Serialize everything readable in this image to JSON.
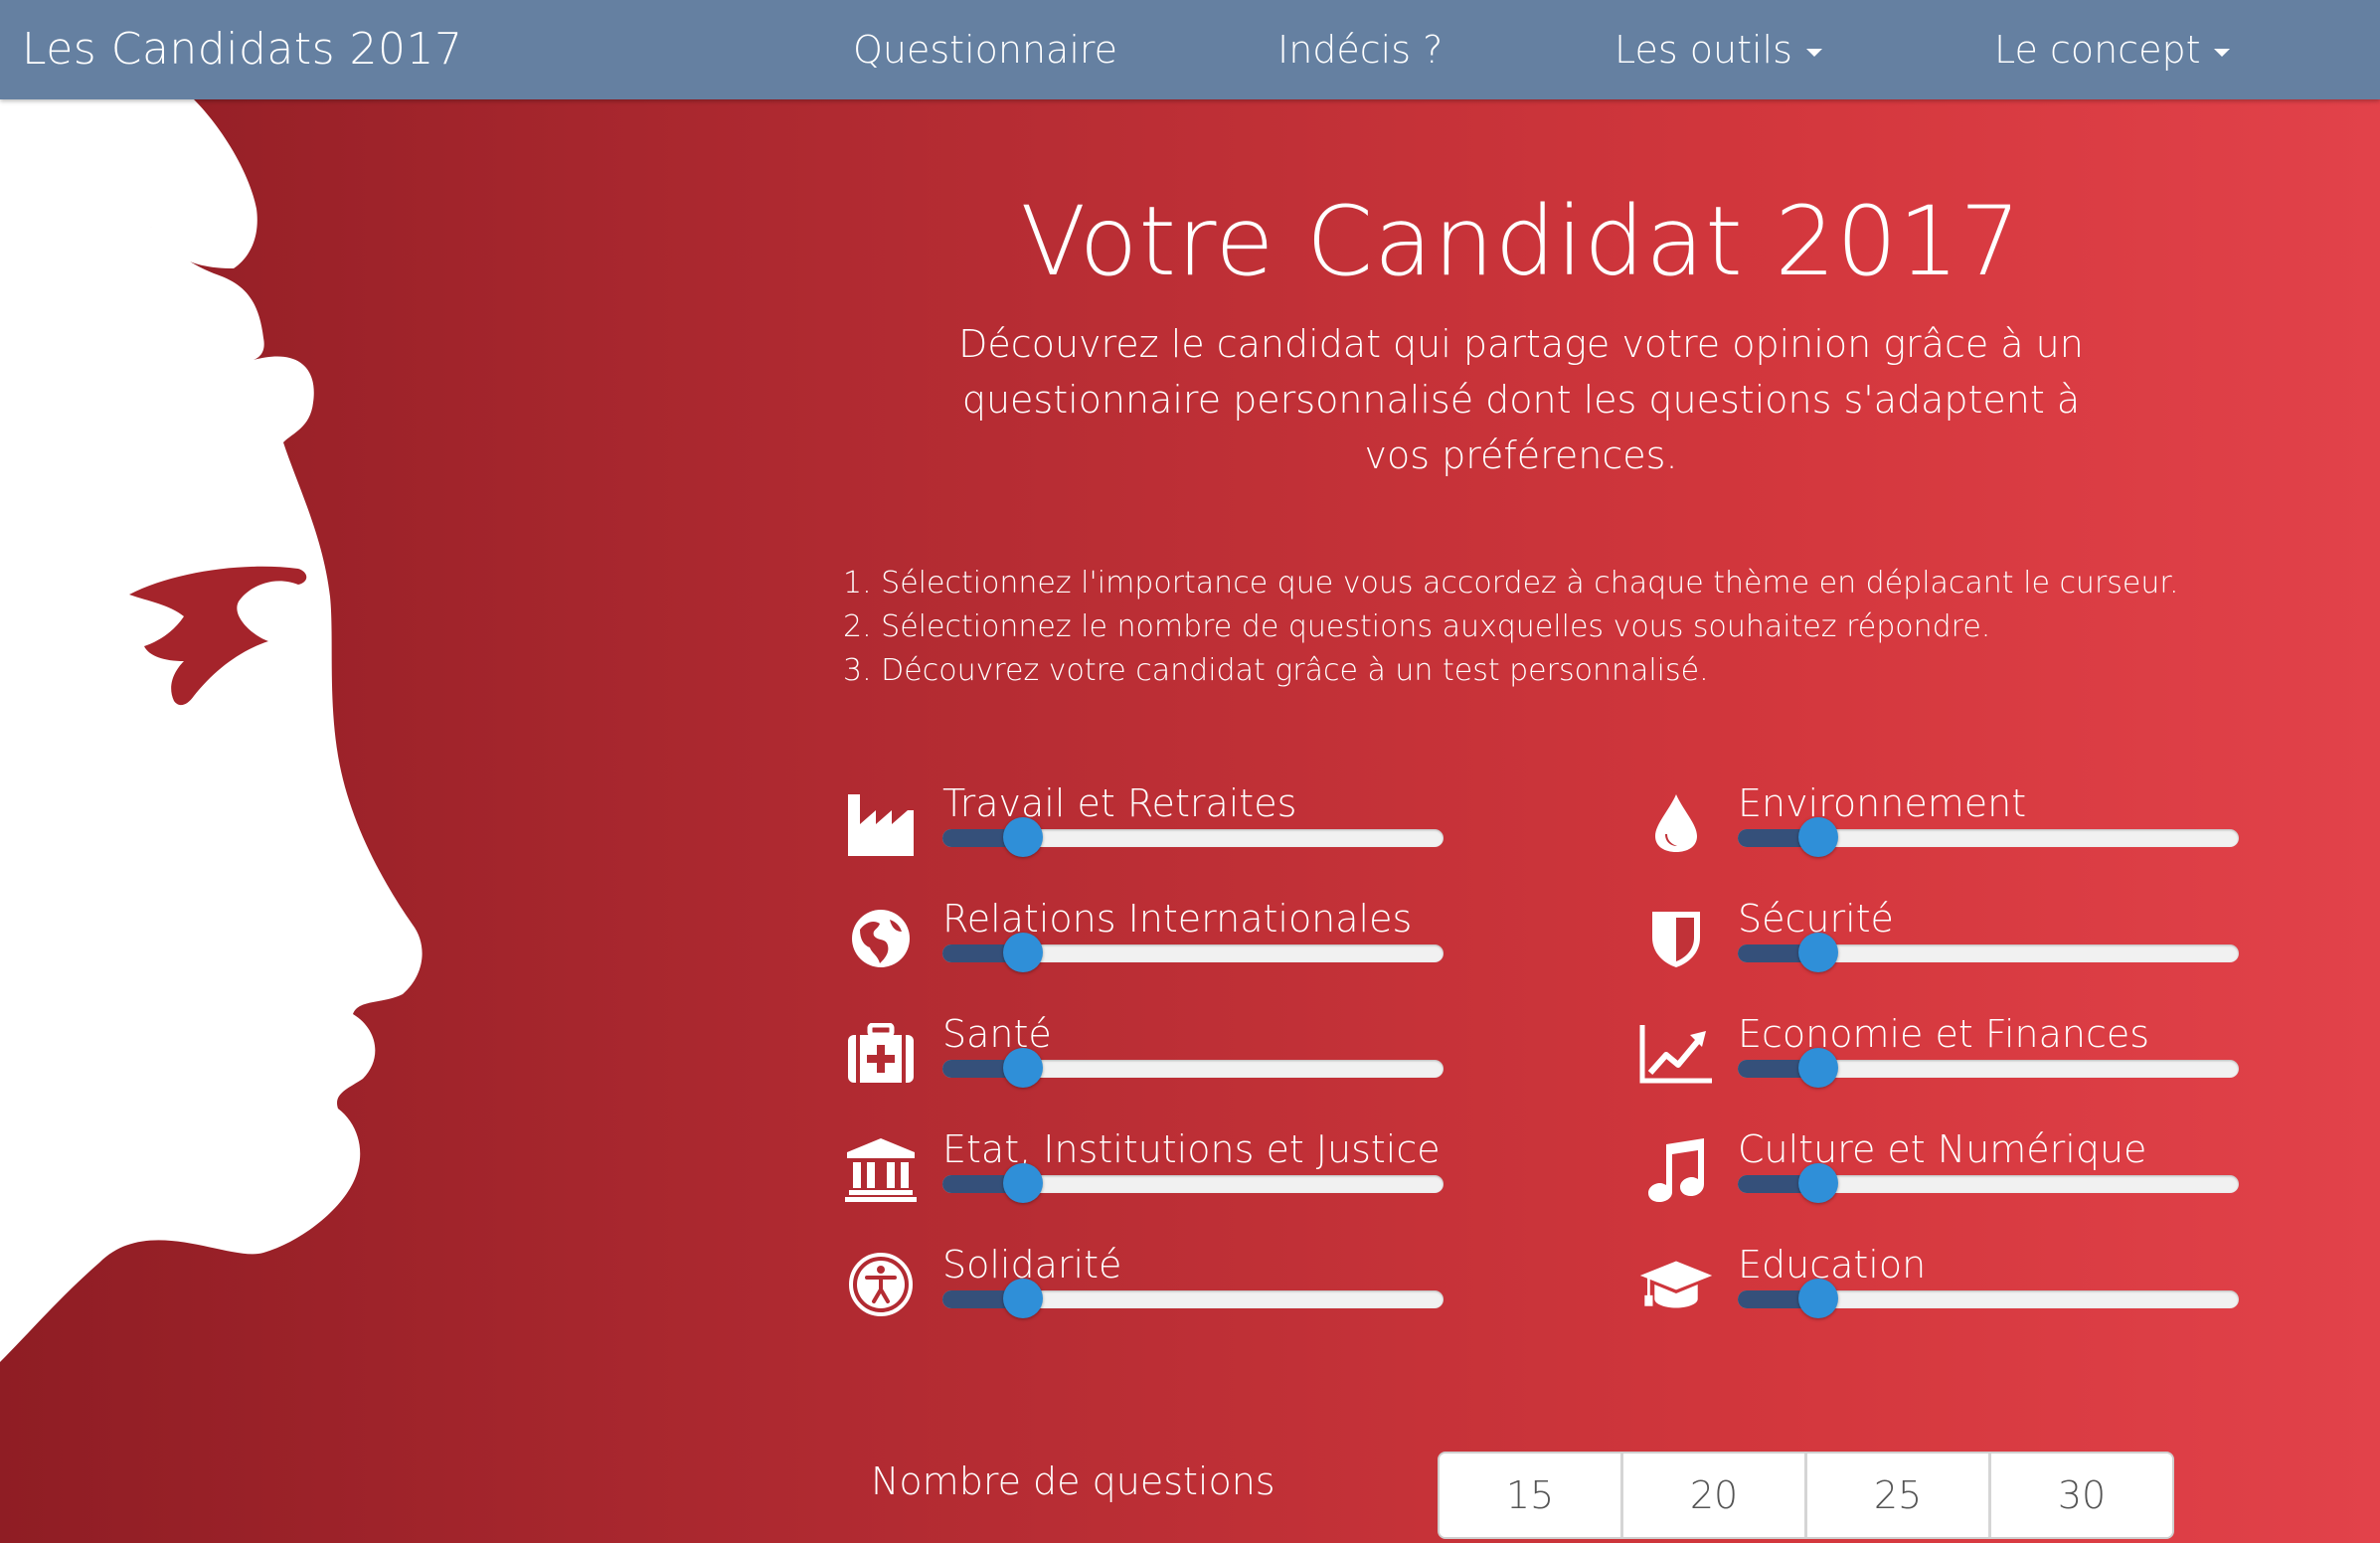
{
  "navbar": {
    "brand": "Les Candidats 2017",
    "items": [
      {
        "label": "Questionnaire",
        "dropdown": false
      },
      {
        "label": "Indécis ?",
        "dropdown": false
      },
      {
        "label": "Les outils",
        "dropdown": true
      },
      {
        "label": "Le concept",
        "dropdown": true
      }
    ]
  },
  "hero": {
    "title": "Votre Candidat 2017",
    "subtitle": "Découvrez le candidat qui partage votre opinion grâce à un questionnaire personnalisé dont les questions s'adaptent à vos préférences."
  },
  "steps": [
    "1. Sélectionnez l'importance que vous accordez à chaque thème en déplacant le curseur.",
    "2. Sélectionnez le nombre de questions auxquelles vous souhaitez répondre.",
    "3. Découvrez votre candidat grâce à un test personnalisé."
  ],
  "themes": [
    {
      "label": "Travail et Retraites",
      "icon": "factory-icon",
      "value": 0.16
    },
    {
      "label": "Environnement",
      "icon": "drop-icon",
      "value": 0.16
    },
    {
      "label": "Relations Internationales",
      "icon": "globe-icon",
      "value": 0.16
    },
    {
      "label": "Sécurité",
      "icon": "shield-icon",
      "value": 0.16
    },
    {
      "label": "Santé",
      "icon": "medkit-icon",
      "value": 0.16
    },
    {
      "label": "Economie et Finances",
      "icon": "line-chart-icon",
      "value": 0.16
    },
    {
      "label": "Etat, Institutions et Justice",
      "icon": "institution-icon",
      "value": 0.16
    },
    {
      "label": "Culture et Numérique",
      "icon": "music-icon",
      "value": 0.16
    },
    {
      "label": "Solidarité",
      "icon": "accessibility-icon",
      "value": 0.16
    },
    {
      "label": "Education",
      "icon": "graduation-cap-icon",
      "value": 0.16
    }
  ],
  "questions": {
    "label": "Nombre de questions",
    "options": [
      "15",
      "20",
      "25",
      "30"
    ]
  },
  "colors": {
    "navbar": "#6580a1",
    "background_start": "#8f1d24",
    "background_end": "#e2424a",
    "slider_fill": "#35507a",
    "slider_thumb": "#2f8fd8"
  }
}
